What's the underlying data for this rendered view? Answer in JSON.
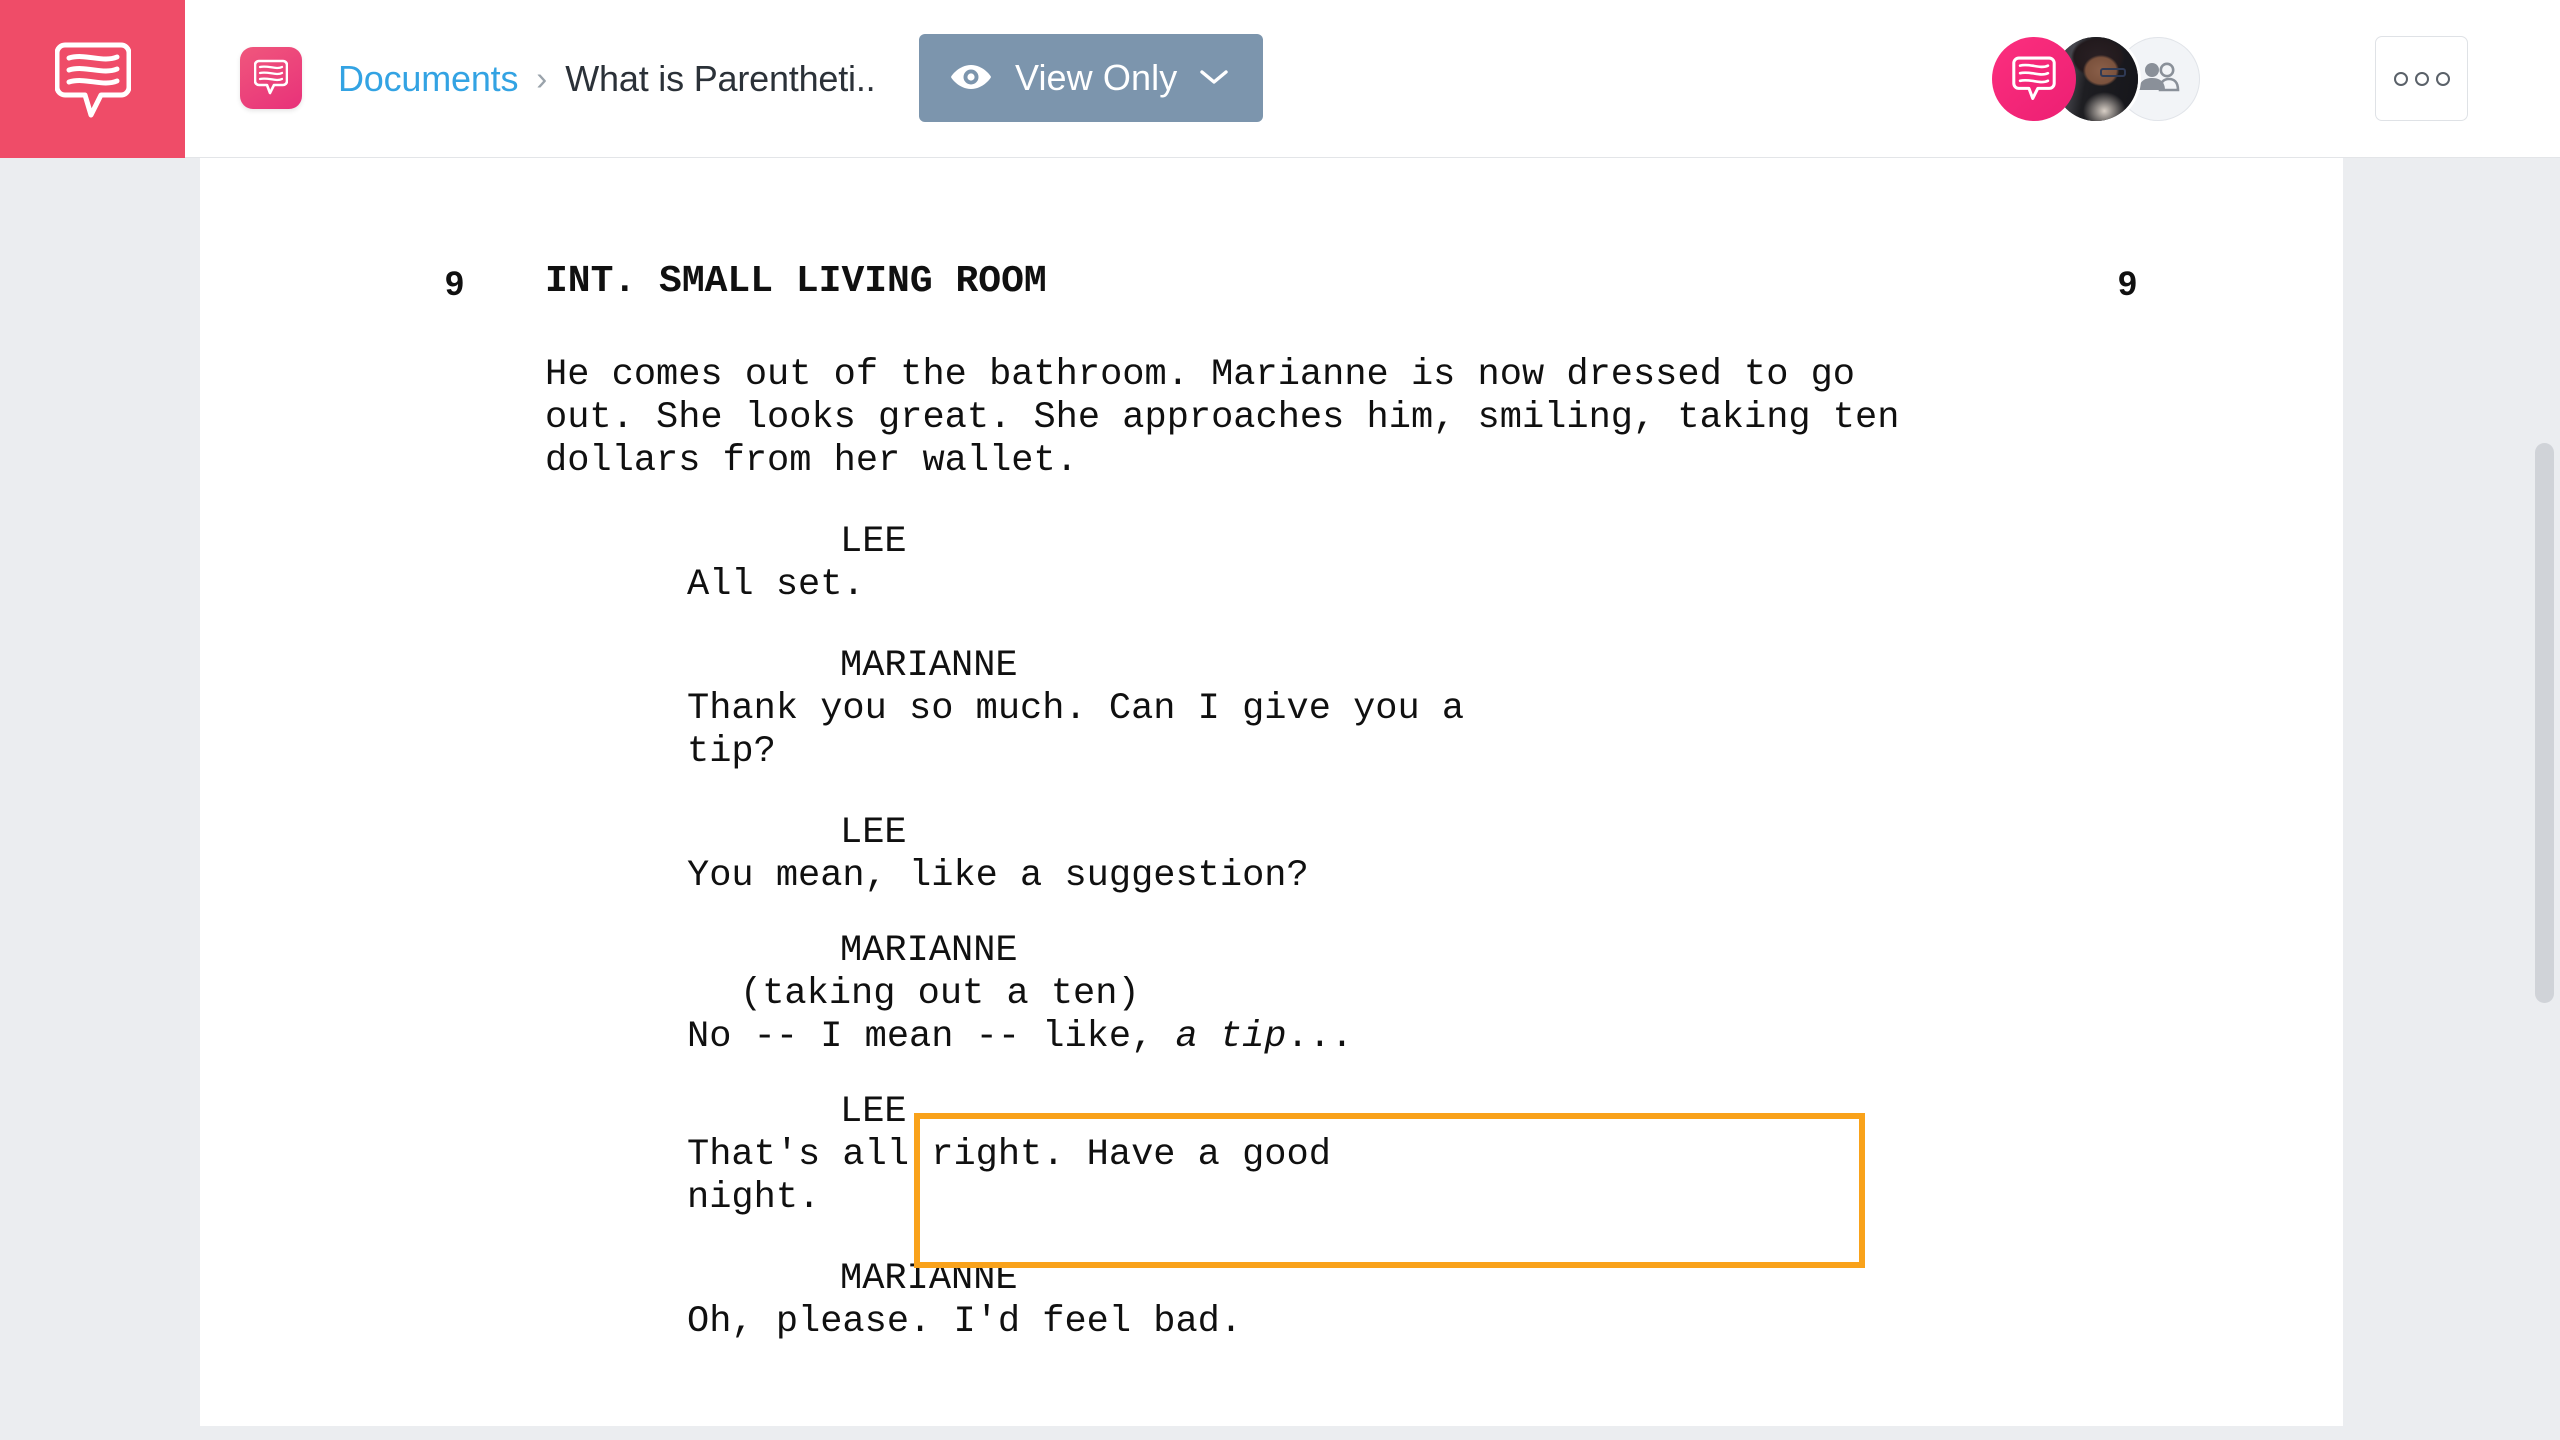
{
  "header": {
    "logo_icon": "speech-bubble-logo",
    "breadcrumb": {
      "doc_icon": "speech-bubble-icon",
      "root": "Documents",
      "separator": "›",
      "current": "What is Parentheti.."
    },
    "view_only_button": {
      "icon": "eye-icon",
      "label": "View Only",
      "chevron": "chevron-down-icon",
      "bg_color": "#7c95ad"
    },
    "avatars": [
      {
        "name": "app-avatar",
        "icon": "speech-bubble-icon",
        "color": "#ec1f73"
      },
      {
        "name": "user-avatar-photo",
        "icon": "user-photo"
      },
      {
        "name": "invite-people-avatar",
        "icon": "people-icon"
      }
    ],
    "more_button": {
      "label": "○○○",
      "icon": "more-options-icon"
    }
  },
  "document": {
    "scene": {
      "number_left": "9",
      "number_right": "9",
      "heading": "INT. SMALL LIVING ROOM"
    },
    "action": "He comes out of the bathroom. Marianne is now dressed to go\nout. She looks great. She approaches him, smiling, taking ten\ndollars from her wallet.",
    "blocks": [
      {
        "id": "lee-1",
        "character": "LEE",
        "parenthetical": "",
        "dialogue": "All set.",
        "highlighted": false
      },
      {
        "id": "marianne-1",
        "character": "MARIANNE",
        "parenthetical": "",
        "dialogue": "Thank you so much. Can I give you a\ntip?",
        "highlighted": false
      },
      {
        "id": "lee-2",
        "character": "LEE",
        "parenthetical": "",
        "dialogue": "You mean, like a suggestion?",
        "highlighted": false
      },
      {
        "id": "marianne-2",
        "character": "MARIANNE",
        "parenthetical": "(taking out a ten)",
        "dialogue_pre": "No -- I mean -- like, ",
        "dialogue_em": "a tip",
        "dialogue_post": "...",
        "highlighted": true
      },
      {
        "id": "lee-3",
        "character": "LEE",
        "parenthetical": "",
        "dialogue": "That's all right. Have a good\nnight.",
        "highlighted": false
      },
      {
        "id": "marianne-3",
        "character": "MARIANNE",
        "parenthetical": "",
        "dialogue": "Oh, please. I'd feel bad.",
        "highlighted": false
      }
    ],
    "highlight_color": "#f9a21a"
  },
  "scrollbar": {
    "name": "vertical-scrollbar"
  }
}
